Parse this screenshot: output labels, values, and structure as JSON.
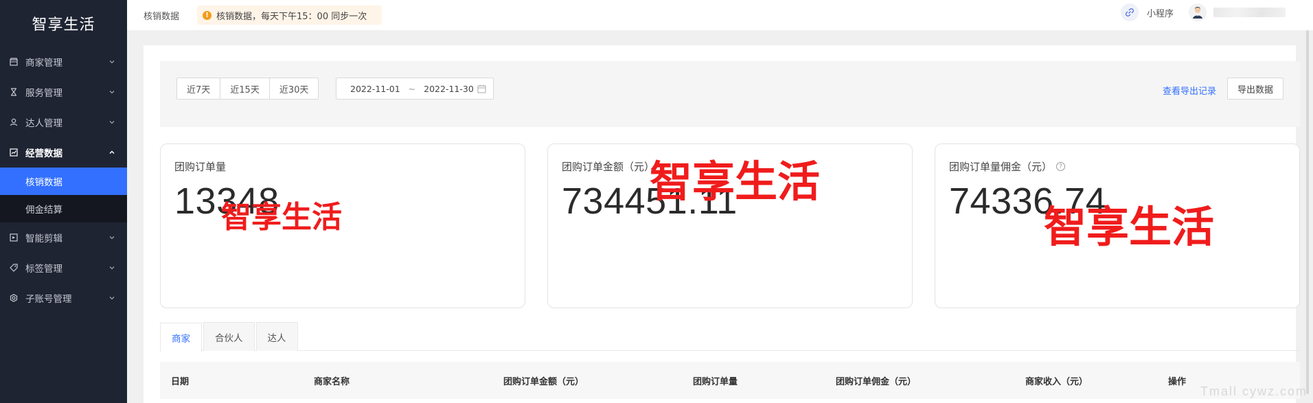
{
  "brand": "智享生活",
  "sidebar": {
    "items": [
      {
        "label": "商家管理",
        "icon": "store-icon"
      },
      {
        "label": "服务管理",
        "icon": "hourglass-icon"
      },
      {
        "label": "达人管理",
        "icon": "user-icon"
      },
      {
        "label": "经营数据",
        "icon": "chart-icon",
        "open": true,
        "children": [
          {
            "label": "核销数据",
            "active": true
          },
          {
            "label": "佣金结算"
          }
        ]
      },
      {
        "label": "智能剪辑",
        "icon": "video-edit-icon"
      },
      {
        "label": "标签管理",
        "icon": "tag-icon"
      },
      {
        "label": "子账号管理",
        "icon": "settings-icon"
      }
    ]
  },
  "topbar": {
    "breadcrumb": "核销数据",
    "notice": "核销数据，每天下午15：00 同步一次",
    "mini_program_label": "小程序"
  },
  "filter": {
    "quick_ranges": [
      "近7天",
      "近15天",
      "近30天"
    ],
    "date_start": "2022-11-01",
    "date_sep": "~",
    "date_end": "2022-11-30",
    "export_records_link": "查看导出记录",
    "export_button": "导出数据"
  },
  "cards": [
    {
      "title": "团购订单量",
      "value": "13348"
    },
    {
      "title": "团购订单金额（元）",
      "value": "734451.11"
    },
    {
      "title": "团购订单量佣金（元）",
      "value": "74336.74"
    }
  ],
  "watermark": "智享生活",
  "tabs": [
    "商家",
    "合伙人",
    "达人"
  ],
  "active_tab": "商家",
  "table": {
    "headers": [
      "日期",
      "商家名称",
      "团购订单金额（元）",
      "团购订单量",
      "团购订单佣金（元）",
      "商家收入（元）",
      "操作"
    ]
  },
  "corner_watermark": "Tmall cywz.com",
  "colors": {
    "sidebar_bg": "#1f2433",
    "accent": "#3370ff",
    "watermark_red": "#f01c1c",
    "notice_bg": "#fff4e8"
  }
}
